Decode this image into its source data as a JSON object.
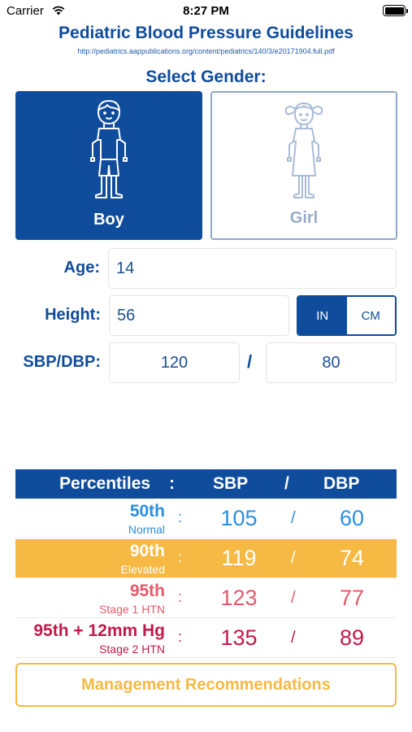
{
  "status_bar": {
    "carrier": "Carrier",
    "time": "8:27 PM"
  },
  "app": {
    "title": "Pediatric Blood Pressure Guidelines",
    "source_link": "http://pediatrics.aappublications.org/content/pediatrics/140/3/e20171904.full.pdf"
  },
  "gender": {
    "prompt": "Select Gender:",
    "boy_label": "Boy",
    "girl_label": "Girl",
    "selected": "Boy"
  },
  "form": {
    "age_label": "Age:",
    "age_value": "14",
    "height_label": "Height:",
    "height_value": "56",
    "unit_in": "IN",
    "unit_cm": "CM",
    "unit_selected": "IN",
    "bp_label": "SBP/DBP:",
    "sbp_value": "120",
    "bp_separator": "/",
    "dbp_value": "80"
  },
  "percentiles": {
    "header": {
      "label": "Percentiles",
      "colon": ":",
      "sbp": "SBP",
      "slash": "/",
      "dbp": "DBP"
    },
    "rows": [
      {
        "name": "50th",
        "sub": "Normal",
        "colon": ":",
        "sbp": "105",
        "slash": "/",
        "dbp": "60",
        "color": "#2a8fe0",
        "bg": "#ffffff"
      },
      {
        "name": "90th",
        "sub": "Elevated",
        "colon": ":",
        "sbp": "119",
        "slash": "/",
        "dbp": "74",
        "color": "#ffffff",
        "bg": "#f6b944"
      },
      {
        "name": "95th",
        "sub": "Stage 1 HTN",
        "colon": ":",
        "sbp": "123",
        "slash": "/",
        "dbp": "77",
        "color": "#e45a6a",
        "bg": "#ffffff"
      },
      {
        "name": "95th + 12mm Hg",
        "sub": "Stage 2 HTN",
        "colon": ":",
        "sbp": "135",
        "slash": "/",
        "dbp": "89",
        "color": "#c21a4a",
        "bg": "#ffffff"
      }
    ]
  },
  "management_button": "Management Recommendations",
  "colors": {
    "primary": "#0f4c9c",
    "accent": "#f6b944",
    "girl_outline": "#8fa8cc"
  },
  "icons": {
    "boy": "boy-figure-icon",
    "girl": "girl-figure-icon",
    "wifi": "wifi-icon",
    "battery": "battery-icon"
  }
}
